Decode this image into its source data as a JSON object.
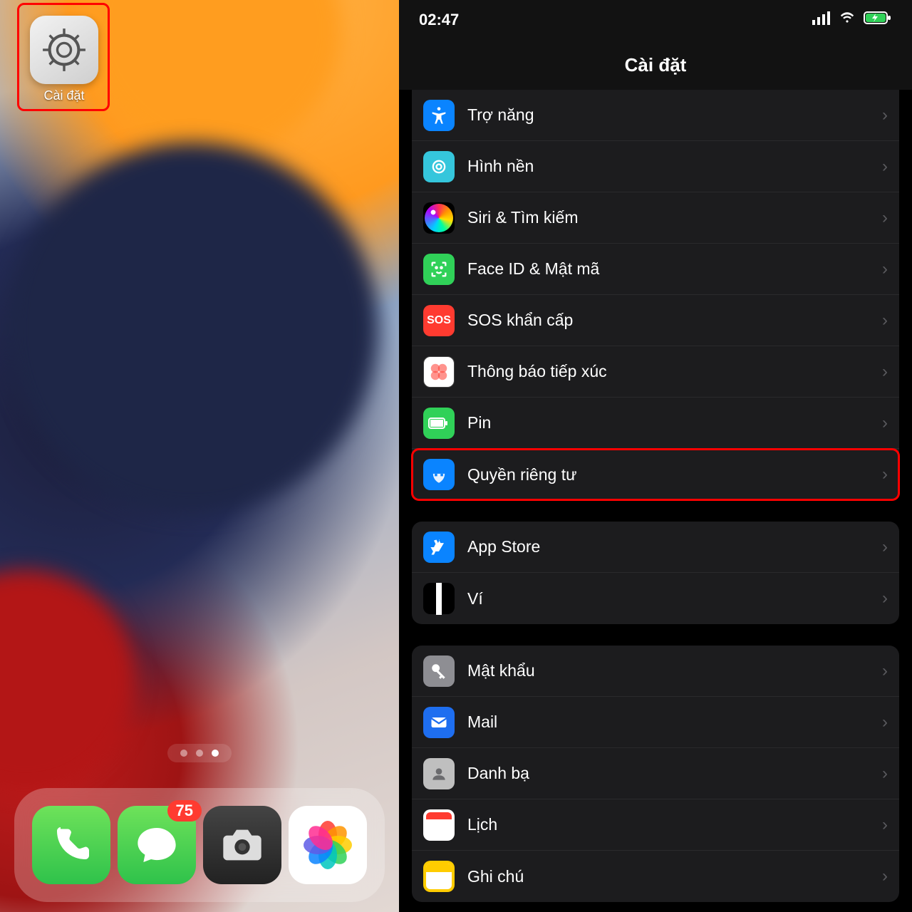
{
  "left": {
    "app": {
      "label": "Cài đặt"
    },
    "dock": {
      "messages_badge": "75"
    }
  },
  "right": {
    "status": {
      "time": "02:47"
    },
    "title": "Cài đặt",
    "group1": [
      {
        "label": "Trợ năng",
        "color": "#0a84ff",
        "icon": "accessibility"
      },
      {
        "label": "Hình nền",
        "color": "#35c6dc",
        "icon": "wallpaper"
      },
      {
        "label": "Siri & Tìm kiếm",
        "color": "#000000",
        "icon": "siri"
      },
      {
        "label": "Face ID & Mật mã",
        "color": "#30d158",
        "icon": "faceid"
      },
      {
        "label": "SOS khẩn cấp",
        "color": "#ff3b30",
        "icon": "sos"
      },
      {
        "label": "Thông báo tiếp xúc",
        "color": "#ffffff",
        "icon": "exposure"
      },
      {
        "label": "Pin",
        "color": "#30d158",
        "icon": "battery"
      },
      {
        "label": "Quyền riêng tư",
        "color": "#0a84ff",
        "icon": "privacy",
        "highlight": true
      }
    ],
    "group2": [
      {
        "label": "App Store",
        "color": "#0a84ff",
        "icon": "appstore"
      },
      {
        "label": "Ví",
        "color": "#000000",
        "icon": "wallet"
      }
    ],
    "group3": [
      {
        "label": "Mật khẩu",
        "color": "#8e8e93",
        "icon": "keys"
      },
      {
        "label": "Mail",
        "color": "#1e6ef0",
        "icon": "mail"
      },
      {
        "label": "Danh bạ",
        "color": "#bfbfbf",
        "icon": "contacts"
      },
      {
        "label": "Lịch",
        "color": "#ffffff",
        "icon": "calendar"
      },
      {
        "label": "Ghi chú",
        "color": "#ffcc00",
        "icon": "notes"
      }
    ]
  }
}
